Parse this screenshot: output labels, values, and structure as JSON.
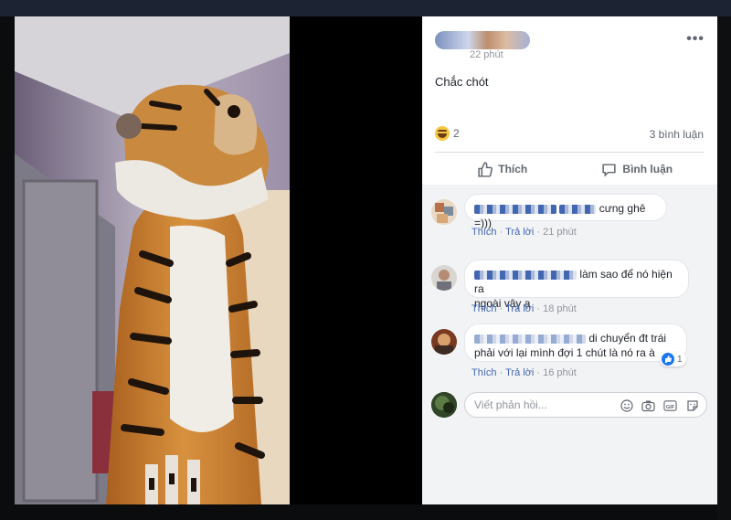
{
  "post": {
    "timestamp": "22 phút",
    "more_label": "•••",
    "text": "Chắc chót",
    "reaction_count": "2",
    "comment_count": "3 bình luận"
  },
  "actions": {
    "like_label": "Thích",
    "comment_label": "Bình luận"
  },
  "comments": [
    {
      "text": "cưng ghê =)))",
      "like_label": "Thích",
      "reply_label": "Trả lời",
      "time": "21 phút"
    },
    {
      "text_line1": "làm sao để nó hiện ra",
      "text_line2": "ngoài vậy ạ",
      "like_label": "Thích",
      "reply_label": "Trả lời",
      "time": "18 phút"
    },
    {
      "text_line1": "di chuyển đt trái",
      "text_line2": "phải với lại mình đợi 1 chút là nó ra à",
      "like_label": "Thích",
      "reply_label": "Trả lời",
      "time": "16 phút",
      "likes": "1"
    }
  ],
  "reply": {
    "placeholder": "Viết phản hồi..."
  },
  "icons": {
    "like": "thumbs-up-icon",
    "comment": "comment-bubble-icon",
    "emoji": "smiley-icon",
    "camera": "camera-icon",
    "gif": "gif-icon",
    "sticker": "sticker-icon"
  },
  "colors": {
    "link": "#4267b2",
    "meta": "#90949c",
    "like_blue": "#1877f2"
  }
}
